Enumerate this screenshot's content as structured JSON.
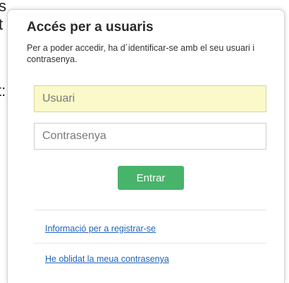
{
  "background": {
    "fragments": [
      "s",
      "t",
      "t:"
    ]
  },
  "login": {
    "title": "Accés per a usuaris",
    "description": "Per a poder accedir, ha d´identificar-se amb el seu usuari i contrasenya.",
    "username": {
      "placeholder": "Usuari",
      "value": ""
    },
    "password": {
      "placeholder": "Contrasenya",
      "value": ""
    },
    "submit_label": "Entrar",
    "register_link": "Informació per a registrar-se",
    "forgot_link": "He oblidat la meua contrasenya"
  },
  "colors": {
    "button": "#48b36a",
    "username_field_bg": "#fbf8c9",
    "link": "#1f63b8"
  }
}
